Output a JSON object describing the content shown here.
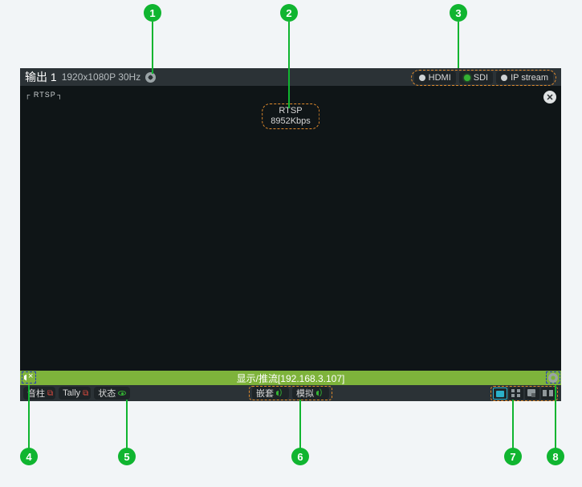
{
  "header": {
    "title": "输出 1",
    "resolution": "1920x1080P 30Hz",
    "io": [
      {
        "label": "HDMI",
        "active": false
      },
      {
        "label": "SDI",
        "active": true
      },
      {
        "label": "IP  stream",
        "active": false
      }
    ]
  },
  "video": {
    "corner_tag": "RTSP",
    "protocol": "RTSP",
    "bitrate": "8952Kbps"
  },
  "status_bar": {
    "text": "显示/推流[192.168.3.107]"
  },
  "bottom": {
    "audio_col": "音柱",
    "tally": "Tally",
    "status": "状态",
    "embedded": "嵌套",
    "analog": "模拟"
  },
  "callouts": {
    "1": "1",
    "2": "2",
    "3": "3",
    "4": "4",
    "5": "5",
    "6": "6",
    "7": "7",
    "8": "8"
  }
}
